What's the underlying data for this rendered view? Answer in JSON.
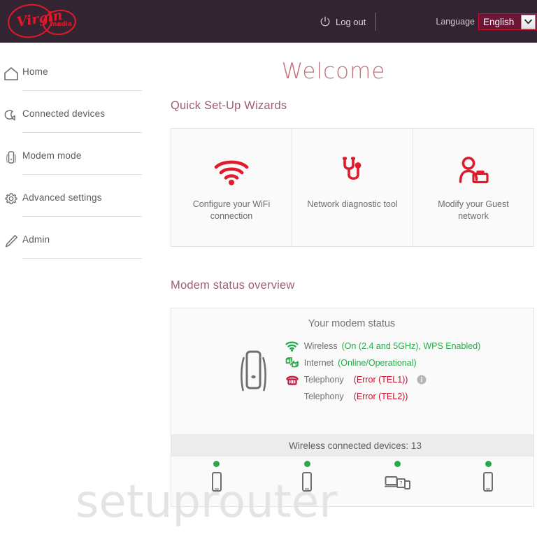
{
  "header": {
    "logo_alt": "Virgin Media",
    "logo_word": "Virgin",
    "logo_sub": "media",
    "logout_label": "Log out",
    "language_label": "Language",
    "language_value": "English",
    "language_options": [
      "English"
    ],
    "bg_color": "#332432",
    "accent_color": "#c8102e"
  },
  "sidebar": {
    "items": [
      {
        "label": "Home",
        "icon": "home-icon"
      },
      {
        "label": "Connected devices",
        "icon": "connected-devices-icon"
      },
      {
        "label": "Modem mode",
        "icon": "modem-icon"
      },
      {
        "label": "Advanced settings",
        "icon": "gear-icon"
      },
      {
        "label": "Admin",
        "icon": "pencil-icon"
      }
    ]
  },
  "main": {
    "page_title": "Welcome",
    "title_color": "#c1727d",
    "wizards": {
      "section_title": "Quick Set-Up Wizards",
      "cards": [
        {
          "label": "Configure your WiFi connection",
          "icon": "wifi-icon"
        },
        {
          "label": "Network diagnostic tool",
          "icon": "stethoscope-icon"
        },
        {
          "label": "Modify your Guest network",
          "icon": "guest-user-icon"
        }
      ]
    },
    "status": {
      "section_title": "Modem status overview",
      "card_heading": "Your modem status",
      "modem_icon": "modem-device-icon",
      "rows": [
        {
          "icon": "wifi-status-icon",
          "name": "Wireless",
          "value": "(On (2.4 and 5GHz), WPS Enabled)",
          "state": "green",
          "info": false
        },
        {
          "icon": "internet-status-icon",
          "name": "Internet",
          "value": "(Online/Operational)",
          "state": "green",
          "info": false
        },
        {
          "icon": "telephone-status-icon",
          "name": "Telephony",
          "value": "(Error (TEL1))",
          "state": "red",
          "info": true
        },
        {
          "icon": "",
          "name": "Telephony",
          "value": "(Error (TEL2))",
          "state": "red",
          "info": false
        }
      ],
      "devices_bar_label": "Wireless connected devices: 13",
      "devices_count": 13,
      "devices": [
        {
          "icon": "phone-icon",
          "status": "online"
        },
        {
          "icon": "phone-icon",
          "status": "online"
        },
        {
          "icon": "multi-device-icon",
          "status": "online"
        },
        {
          "icon": "phone-icon",
          "status": "online"
        }
      ]
    }
  },
  "watermark": {
    "text": "setuprouter"
  }
}
